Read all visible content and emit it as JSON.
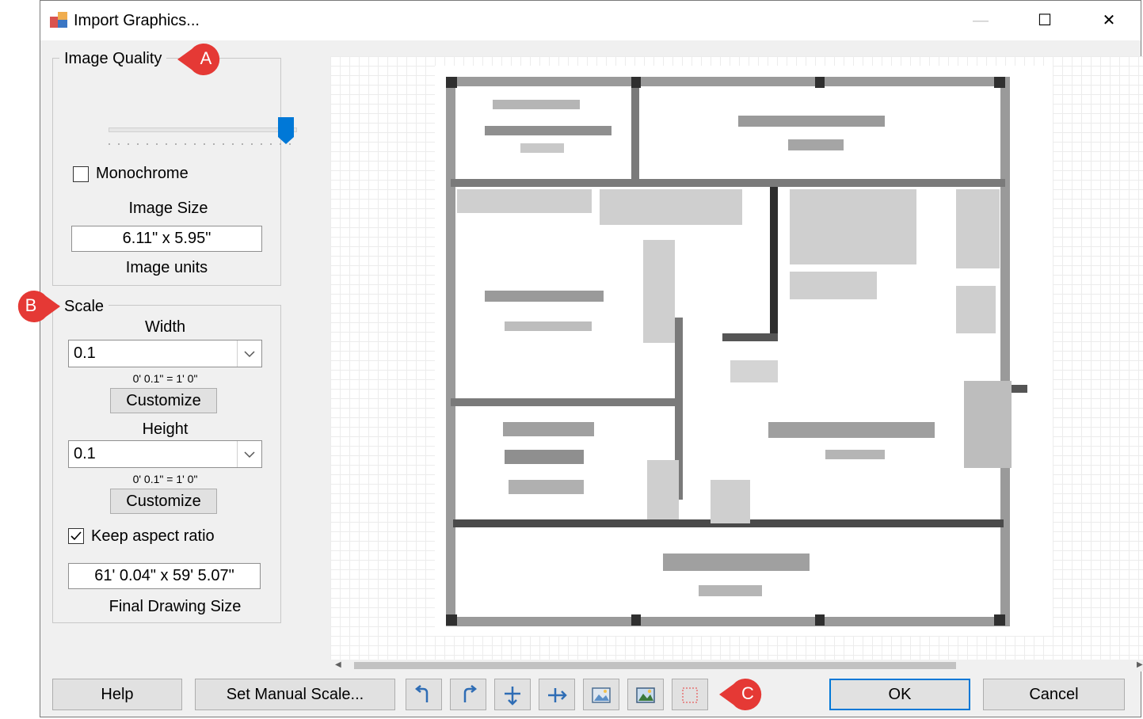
{
  "window": {
    "title": "Import Graphics...",
    "minimize_glyph": "—",
    "maximize_glyph": "☐",
    "close_glyph": "✕"
  },
  "image_quality": {
    "group_label": "Image Quality",
    "slider_value_fraction": 1.0,
    "monochrome_label": "Monochrome",
    "monochrome_checked": false,
    "image_size_label": "Image Size",
    "image_size_value": "6.11\" x 5.95\"",
    "image_units_label": "Image units"
  },
  "scale": {
    "group_label": "Scale",
    "width_label": "Width",
    "width_value": "0.1",
    "width_ratio": "0' 0.1\" = 1' 0\"",
    "customize_label": "Customize",
    "height_label": "Height",
    "height_value": "0.1",
    "height_ratio": "0' 0.1\" = 1' 0\"",
    "keep_aspect_label": "Keep aspect ratio",
    "keep_aspect_checked": true,
    "final_size_value": "61' 0.04\" x 59' 5.07\"",
    "final_size_label": "Final Drawing Size"
  },
  "footer": {
    "help_label": "Help",
    "manual_scale_label": "Set Manual Scale...",
    "ok_label": "OK",
    "cancel_label": "Cancel"
  },
  "toolbar": {
    "icons": [
      "rotate-left-icon",
      "rotate-right-icon",
      "flip-vertical-icon",
      "flip-horizontal-icon",
      "image-icon",
      "image-color-icon",
      "crop-select-icon"
    ]
  },
  "callouts": {
    "a": "A",
    "b": "B",
    "c": "C"
  },
  "colors": {
    "callout_red": "#e53935",
    "accent_blue": "#0078d7",
    "ok_border": "#0078d7"
  }
}
